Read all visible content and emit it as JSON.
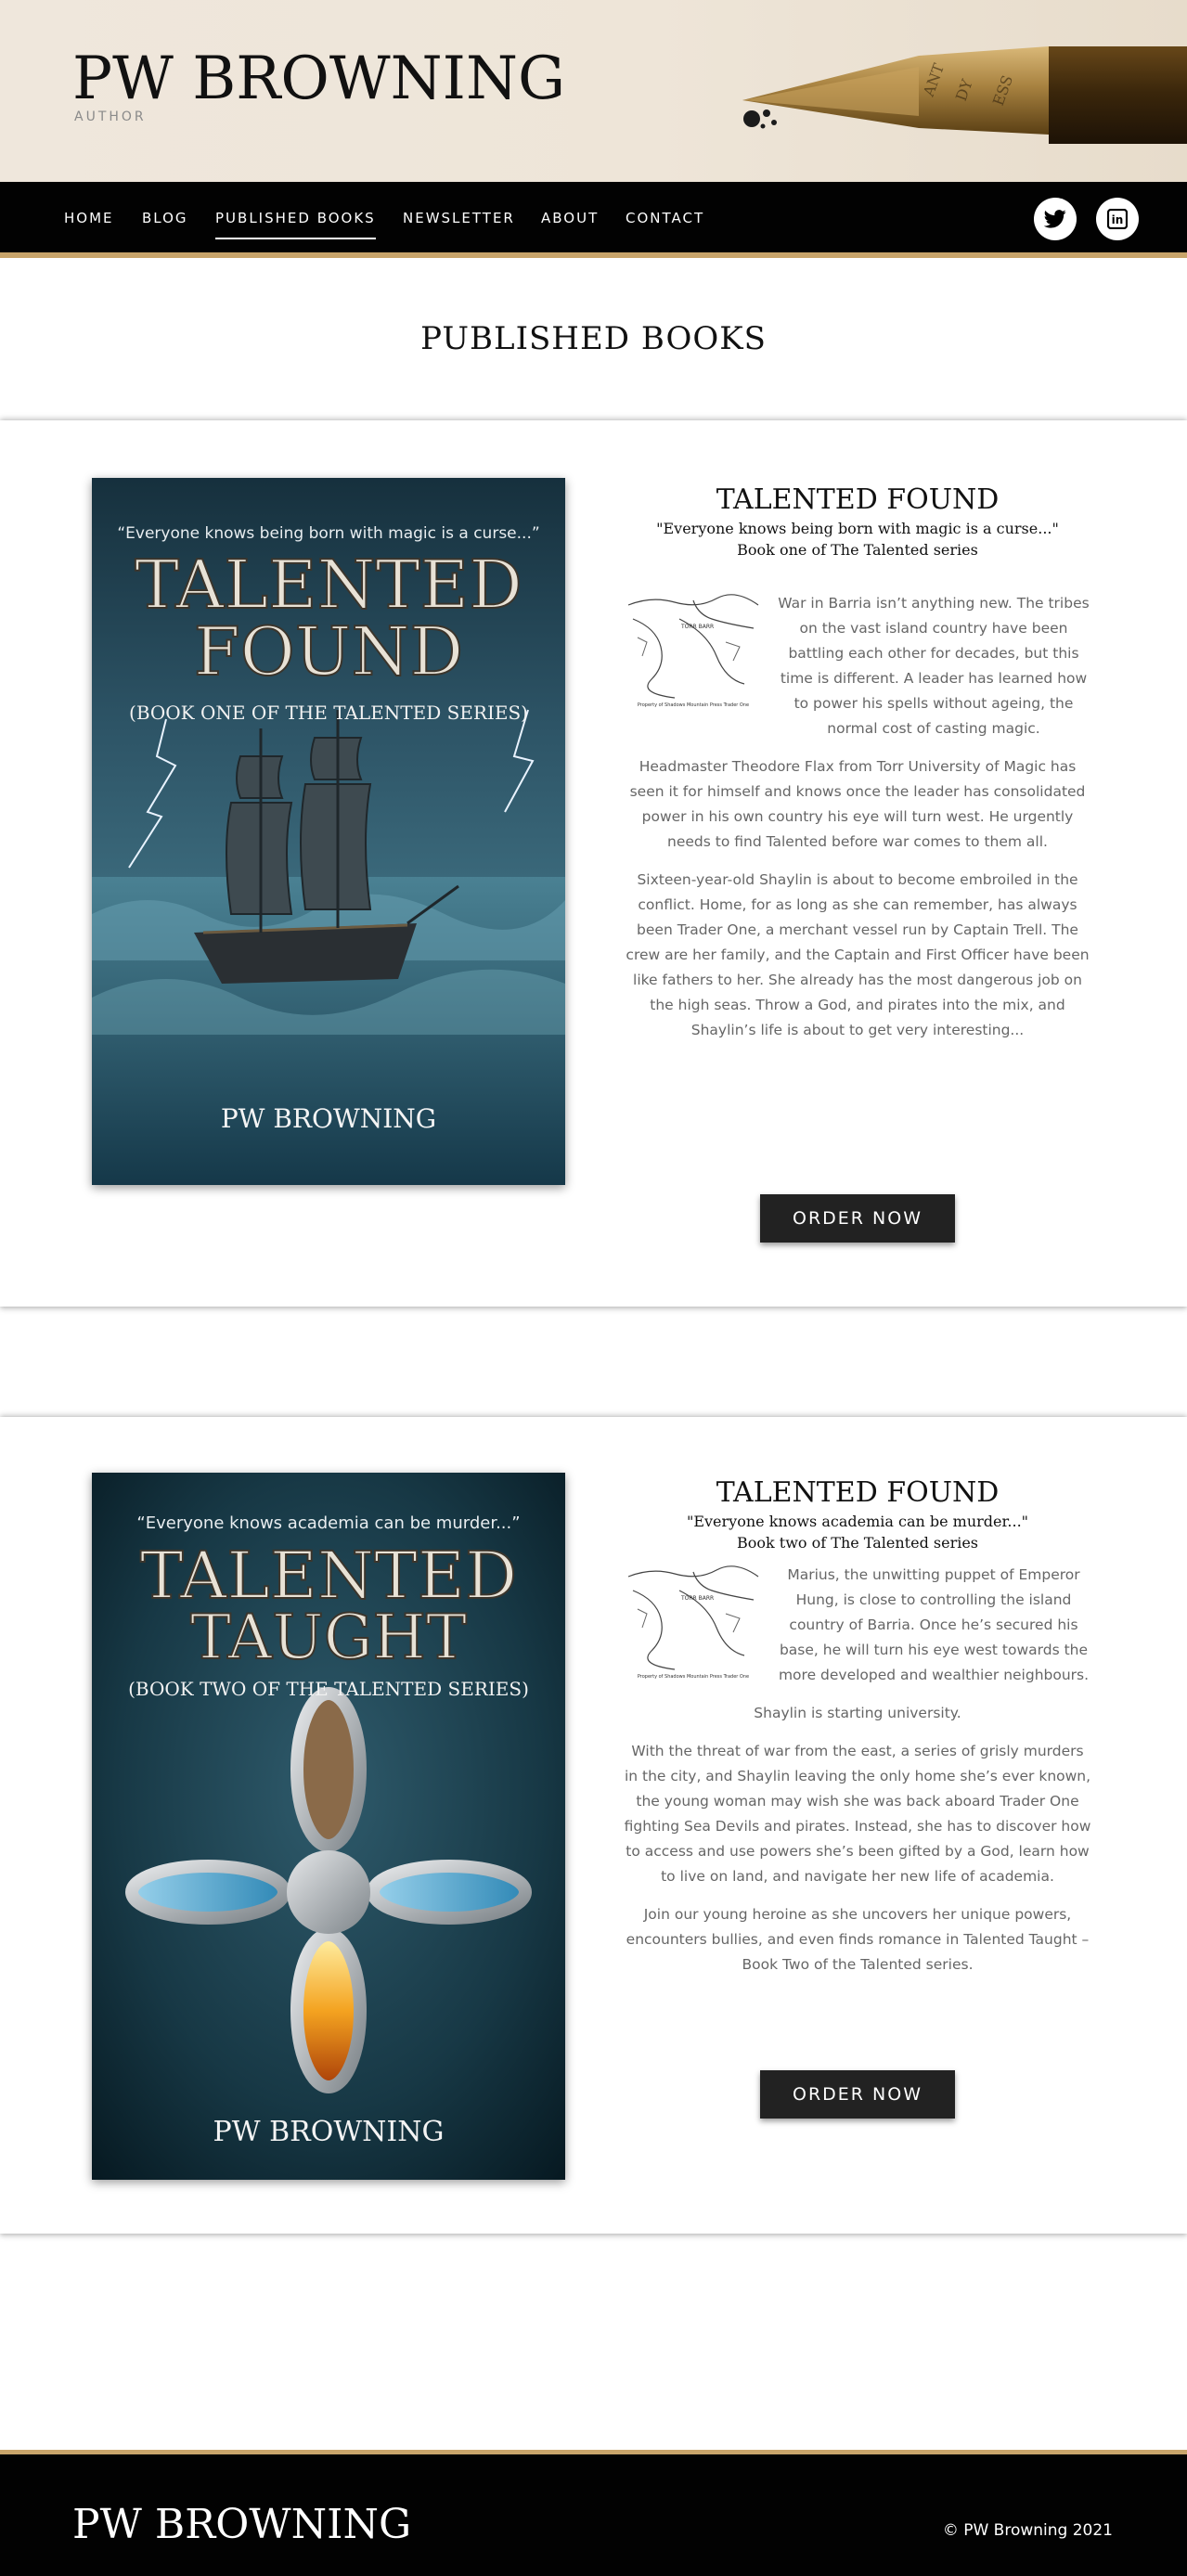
{
  "header": {
    "site_title": "PW BROWNING",
    "tagline": "AUTHOR",
    "pen_engraving": "ANT  DY  ESS"
  },
  "nav": {
    "items": [
      "HOME",
      "BLOG",
      "PUBLISHED BOOKS",
      "NEWSLETTER",
      "ABOUT",
      "CONTACT"
    ],
    "active": "PUBLISHED BOOKS",
    "social": [
      "twitter-icon",
      "linkedin-icon"
    ],
    "social_labels": {
      "linkedin": "in"
    }
  },
  "page_title": "PUBLISHED BOOKS",
  "books": [
    {
      "cover": {
        "tagline": "“Everyone knows being born with magic is a curse...”",
        "title_line1": "TALENTED",
        "title_line2": "FOUND",
        "subtitle": "(BOOK ONE OF THE TALENTED SERIES)",
        "author": "PW BROWNING"
      },
      "title": "TALENTED FOUND",
      "quote": "\"Everyone knows being born with magic is a curse...\"",
      "series": "Book one of The Talented series",
      "paragraphs": [
        "War in Barria isn’t anything new. The tribes on the vast island country have been battling each other for decades, but this time is different. A leader has learned how to power his spells without ageing, the normal cost of casting magic.",
        "Headmaster Theodore Flax from Torr University of Magic has seen it for himself and knows once the leader has consolidated power in his own country his eye will turn west. He urgently needs to find Talented before war comes to them all.",
        "Sixteen-year-old Shaylin is about to become embroiled in the conflict. Home, for as long as she can remember, has always been Trader One, a merchant vessel run by Captain Trell. The crew are her family, and the Captain and First Officer have been like fathers to her. She already has the most dangerous job on the high seas. Throw a God, and pirates into the mix, and Shaylin’s life is about to get very interesting..."
      ],
      "button": "ORDER NOW"
    },
    {
      "cover": {
        "tagline": "“Everyone knows academia can be murder...”",
        "title_line1": "TALENTED",
        "title_line2": "TAUGHT",
        "subtitle": "(BOOK TWO OF THE TALENTED SERIES)",
        "author": "PW BROWNING"
      },
      "title": "TALENTED FOUND",
      "quote": "\"Everyone knows academia can be murder...\"",
      "series": "Book two of The Talented series",
      "paragraphs": [
        "Marius, the unwitting puppet of Emperor Hung, is close to controlling the island country of Barria. Once he’s secured his base, he will turn his eye west towards the more developed and wealthier neighbours.",
        "Shaylin is starting university.",
        "With the threat of war from the east, a series of grisly murders in the city, and Shaylin leaving the only home she’s ever known, the young woman may wish she was back aboard Trader One fighting Sea Devils and pirates. Instead, she has to discover how to access and use powers she’s been gifted by a God, learn how to live on land, and navigate her new life of academia.",
        "Join our young heroine as she uncovers her unique powers, encounters bullies, and even finds romance in Talented Taught – Book Two of the Talented series."
      ],
      "button": "ORDER NOW"
    }
  ],
  "map_labels": {
    "region": "TORR BARR",
    "caption": "Property of Shadows Mountain Press   Trader One"
  },
  "footer": {
    "site_title": "PW BROWNING",
    "copyright": "© PW Browning 2021"
  },
  "colors": {
    "nav_bg": "#020202",
    "accent_gold": "#c8a46a",
    "button_bg": "#222222"
  }
}
